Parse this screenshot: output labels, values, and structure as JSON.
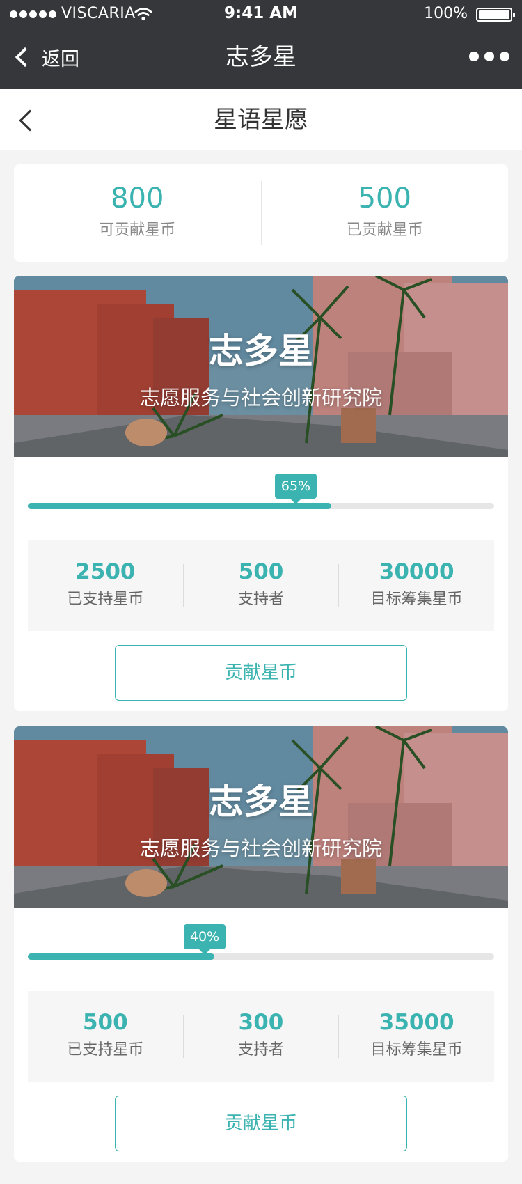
{
  "status_bar": {
    "carrier": "VISCARIA",
    "time": "9:41 AM",
    "battery": "100%"
  },
  "wechat_nav": {
    "back_label": "返回",
    "title": "志多星"
  },
  "page": {
    "title": "星语星愿"
  },
  "summary": {
    "available": {
      "value": "800",
      "label": "可贡献星币"
    },
    "contributed": {
      "value": "500",
      "label": "已贡献星币"
    }
  },
  "projects": [
    {
      "banner_title": "志多星",
      "banner_subtitle": "志愿服务与社会创新研究院",
      "progress": 0.65,
      "progress_label": "65%",
      "stats": [
        {
          "value": "2500",
          "label": "已支持星币"
        },
        {
          "value": "500",
          "label": "支持者"
        },
        {
          "value": "30000",
          "label": "目标筹集星币"
        }
      ],
      "button_label": "贡献星币"
    },
    {
      "banner_title": "志多星",
      "banner_subtitle": "志愿服务与社会创新研究院",
      "progress": 0.4,
      "progress_label": "40%",
      "stats": [
        {
          "value": "500",
          "label": "已支持星币"
        },
        {
          "value": "300",
          "label": "支持者"
        },
        {
          "value": "35000",
          "label": "目标筹集星币"
        }
      ],
      "button_label": "贡献星币"
    }
  ],
  "colors": {
    "accent": "#3bb3b0",
    "nav_bg": "#36373a",
    "page_bg": "#f4f4f4"
  }
}
